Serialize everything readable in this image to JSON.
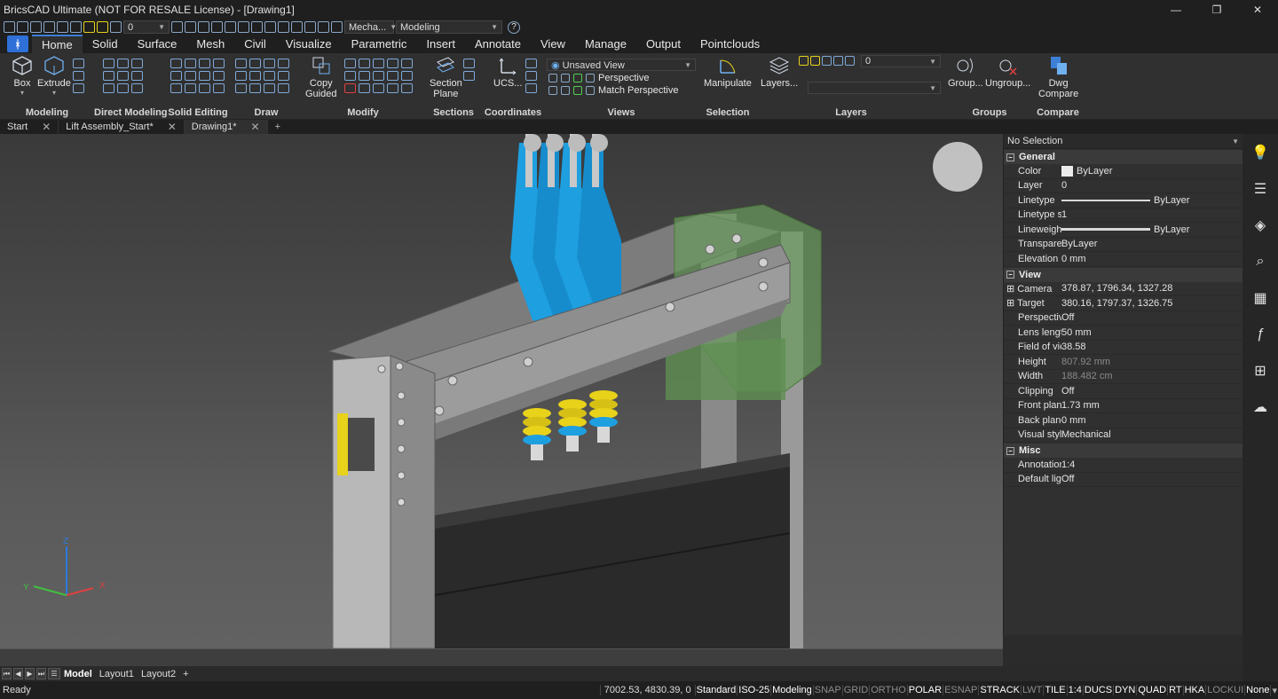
{
  "app": {
    "title": "BricsCAD Ultimate (NOT FOR RESALE License) - [Drawing1]",
    "window_buttons": [
      "—",
      "❐",
      "✕"
    ]
  },
  "qat": {
    "layer_value": "0",
    "workspace_short": "Mecha...",
    "workspace": "Modeling",
    "help": "?"
  },
  "ribbon_tabs": [
    "Home",
    "Solid",
    "Surface",
    "Mesh",
    "Civil",
    "Visualize",
    "Parametric",
    "Insert",
    "Annotate",
    "View",
    "Manage",
    "Output",
    "Pointclouds"
  ],
  "ribbon": {
    "modeling": {
      "label": "Modeling",
      "box": "Box",
      "extrude": "Extrude"
    },
    "direct_modeling": {
      "label": "Direct Modeling"
    },
    "solid_editing": {
      "label": "Solid Editing"
    },
    "draw": {
      "label": "Draw"
    },
    "modify": {
      "label": "Modify",
      "copy_guided_1": "Copy",
      "copy_guided_2": "Guided"
    },
    "sections": {
      "label": "Sections",
      "section_plane_1": "Section",
      "section_plane_2": "Plane"
    },
    "coordinates": {
      "label": "Coordinates",
      "ucs": "UCS..."
    },
    "views": {
      "label": "Views",
      "saved_view": "Unsaved View",
      "perspective": "Perspective",
      "match_perspective": "Match Perspective"
    },
    "selection": {
      "label": "Selection",
      "manipulate": "Manipulate"
    },
    "layers": {
      "label": "Layers",
      "layers_btn": "Layers...",
      "layer_value": "0"
    },
    "groups": {
      "label": "Groups",
      "group": "Group...",
      "ungroup": "Ungroup..."
    },
    "compare": {
      "label": "Compare",
      "dwg_compare_1": "Dwg",
      "dwg_compare_2": "Compare"
    }
  },
  "doc_tabs": [
    "Start",
    "Lift Assembly_Start*",
    "Drawing1*"
  ],
  "properties": {
    "selection": "No Selection",
    "sections": [
      {
        "name": "General",
        "rows": [
          {
            "key": "Color",
            "value": "ByLayer"
          },
          {
            "key": "Layer",
            "value": "0"
          },
          {
            "key": "Linetype",
            "value": "ByLayer"
          },
          {
            "key": "Linetype sc",
            "value": "1"
          },
          {
            "key": "Lineweight",
            "value": "ByLayer"
          },
          {
            "key": "Transparen",
            "value": "ByLayer"
          },
          {
            "key": "Elevation",
            "value": "0 mm"
          }
        ]
      },
      {
        "name": "View",
        "rows": [
          {
            "key": "Camera",
            "value": "378.87, 1796.34, 1327.28"
          },
          {
            "key": "Target",
            "value": "380.16, 1797.37, 1326.75"
          },
          {
            "key": "Perspective",
            "value": "Off"
          },
          {
            "key": "Lens length",
            "value": "50 mm"
          },
          {
            "key": "Field of vie",
            "value": "38.58"
          },
          {
            "key": "Height",
            "value": "807.92 mm"
          },
          {
            "key": "Width",
            "value": "188.482 cm"
          },
          {
            "key": "Clipping",
            "value": "Off"
          },
          {
            "key": "Front plane",
            "value": "1.73 mm"
          },
          {
            "key": "Back plane",
            "value": "0 mm"
          },
          {
            "key": "Visual style",
            "value": "Mechanical"
          }
        ]
      },
      {
        "name": "Misc",
        "rows": [
          {
            "key": "Annotation",
            "value": "1:4"
          },
          {
            "key": "Default ligh",
            "value": "Off"
          }
        ]
      }
    ]
  },
  "layout_tabs": [
    "Model",
    "Layout1",
    "Layout2",
    "+"
  ],
  "status": {
    "ready": "Ready",
    "coords": "7002.53, 4830.39, 0",
    "items": [
      {
        "text": "Standard",
        "state": "on"
      },
      {
        "text": "ISO-25",
        "state": "on"
      },
      {
        "text": "Modeling",
        "state": "on"
      },
      {
        "text": "SNAP",
        "state": "off"
      },
      {
        "text": "GRID",
        "state": "off"
      },
      {
        "text": "ORTHO",
        "state": "off"
      },
      {
        "text": "POLAR",
        "state": "on"
      },
      {
        "text": "ESNAP",
        "state": "off"
      },
      {
        "text": "STRACK",
        "state": "on"
      },
      {
        "text": "LWT",
        "state": "off"
      },
      {
        "text": "TILE",
        "state": "on"
      },
      {
        "text": "1:4",
        "state": "on"
      },
      {
        "text": "DUCS",
        "state": "on"
      },
      {
        "text": "DYN",
        "state": "on"
      },
      {
        "text": "QUAD",
        "state": "on"
      },
      {
        "text": "RT",
        "state": "on"
      },
      {
        "text": "HKA",
        "state": "on"
      },
      {
        "text": "LOCKUI",
        "state": "off"
      },
      {
        "text": "None",
        "state": "on"
      }
    ]
  },
  "viewport": {
    "axis_labels": [
      "X",
      "Y",
      "Z"
    ]
  },
  "colors": {
    "accent": "#3c7fd6",
    "blue_part": "#1e9fe0",
    "spring": "#e8d21a",
    "green_bracket": "#6a9a5c"
  }
}
